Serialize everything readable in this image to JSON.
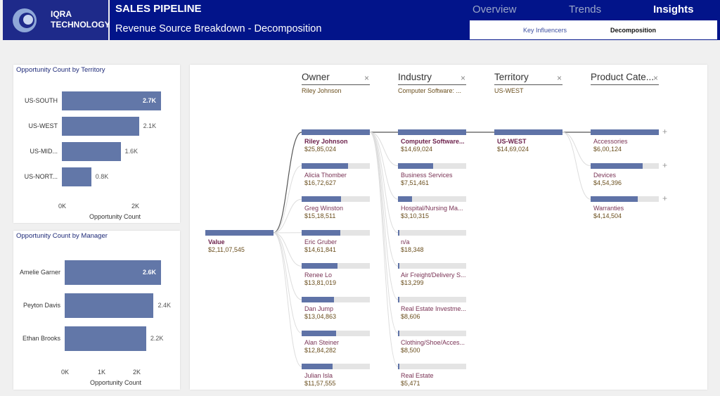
{
  "header": {
    "logo_line1": "IQRA",
    "logo_line2": "TECHNOLOGY",
    "title": "SALES PIPELINE",
    "subtitle": "Revenue Source Breakdown - Decomposition",
    "tabs": [
      "Overview",
      "Trends",
      "Insights"
    ],
    "subtabs": [
      "Key Influencers",
      "Decomposition"
    ]
  },
  "territory_chart": {
    "title": "Opportunity Count by Territory",
    "xlabel": "Opportunity Count",
    "ticks": [
      "0K",
      "2K"
    ]
  },
  "manager_chart": {
    "title": "Opportunity Count by Manager",
    "xlabel": "Opportunity Count",
    "ticks": [
      "0K",
      "1K",
      "2K"
    ]
  },
  "chart_data": [
    {
      "type": "bar",
      "orientation": "horizontal",
      "title": "Opportunity Count by Territory",
      "categories": [
        "US-SOUTH",
        "US-WEST",
        "US-MID...",
        "US-NORT..."
      ],
      "values": [
        2.7,
        2.1,
        1.6,
        0.8
      ],
      "value_labels": [
        "2.7K",
        "2.1K",
        "1.6K",
        "0.8K"
      ],
      "xlabel": "Opportunity Count",
      "xlim": [
        0,
        2.7
      ]
    },
    {
      "type": "bar",
      "orientation": "horizontal",
      "title": "Opportunity Count by Manager",
      "categories": [
        "Amelie Garner",
        "Peyton Davis",
        "Ethan Brooks"
      ],
      "values": [
        2.6,
        2.4,
        2.2
      ],
      "value_labels": [
        "2.6K",
        "2.4K",
        "2.2K"
      ],
      "xlabel": "Opportunity Count",
      "xlim": [
        0,
        2.6
      ]
    }
  ],
  "decomp": {
    "root": {
      "label": "Value",
      "value": "$2,11,07,545"
    },
    "levels": [
      {
        "header": "Owner",
        "selected": "Riley Johnson",
        "nodes": [
          {
            "label": "Riley Johnson",
            "value": "$25,85,024",
            "fill": 1.0
          },
          {
            "label": "Alicia Thomber",
            "value": "$16,72,627",
            "fill": 0.68
          },
          {
            "label": "Greg Winston",
            "value": "$15,18,511",
            "fill": 0.58
          },
          {
            "label": "Eric Gruber",
            "value": "$14,61,841",
            "fill": 0.57
          },
          {
            "label": "Renee Lo",
            "value": "$13,81,019",
            "fill": 0.53
          },
          {
            "label": "Dan Jump",
            "value": "$13,04,863",
            "fill": 0.47
          },
          {
            "label": "Alan Steiner",
            "value": "$12,84,282",
            "fill": 0.5
          },
          {
            "label": "Julian Isla",
            "value": "$11,57,555",
            "fill": 0.45
          }
        ]
      },
      {
        "header": "Industry",
        "selected": "Computer Software: ...",
        "nodes": [
          {
            "label": "Computer Software...",
            "value": "$14,69,024",
            "fill": 1.0
          },
          {
            "label": "Business Services",
            "value": "$7,51,461",
            "fill": 0.52
          },
          {
            "label": "Hospital/Nursing Ma...",
            "value": "$3,10,315",
            "fill": 0.21
          },
          {
            "label": "n/a",
            "value": "$18,348",
            "fill": 0.02
          },
          {
            "label": "Air Freight/Delivery S...",
            "value": "$13,299",
            "fill": 0.015
          },
          {
            "label": "Real Estate Investme...",
            "value": "$8,606",
            "fill": 0.01
          },
          {
            "label": "Clothing/Shoe/Acces...",
            "value": "$8,500",
            "fill": 0.01
          },
          {
            "label": "Real Estate",
            "value": "$5,471",
            "fill": 0.008
          }
        ]
      },
      {
        "header": "Territory",
        "selected": "US-WEST",
        "nodes": [
          {
            "label": "US-WEST",
            "value": "$14,69,024",
            "fill": 1.0
          }
        ]
      },
      {
        "header": "Product Cate...",
        "selected": "",
        "nodes": [
          {
            "label": "Accessories",
            "value": "$6,00,124",
            "fill": 1.0
          },
          {
            "label": "Devices",
            "value": "$4,54,396",
            "fill": 0.76
          },
          {
            "label": "Warranties",
            "value": "$4,14,504",
            "fill": 0.69
          }
        ]
      }
    ]
  },
  "colors": {
    "header_bg": "#02148a",
    "bar": "#6277a8",
    "accent_text": "#6b1f4a"
  }
}
